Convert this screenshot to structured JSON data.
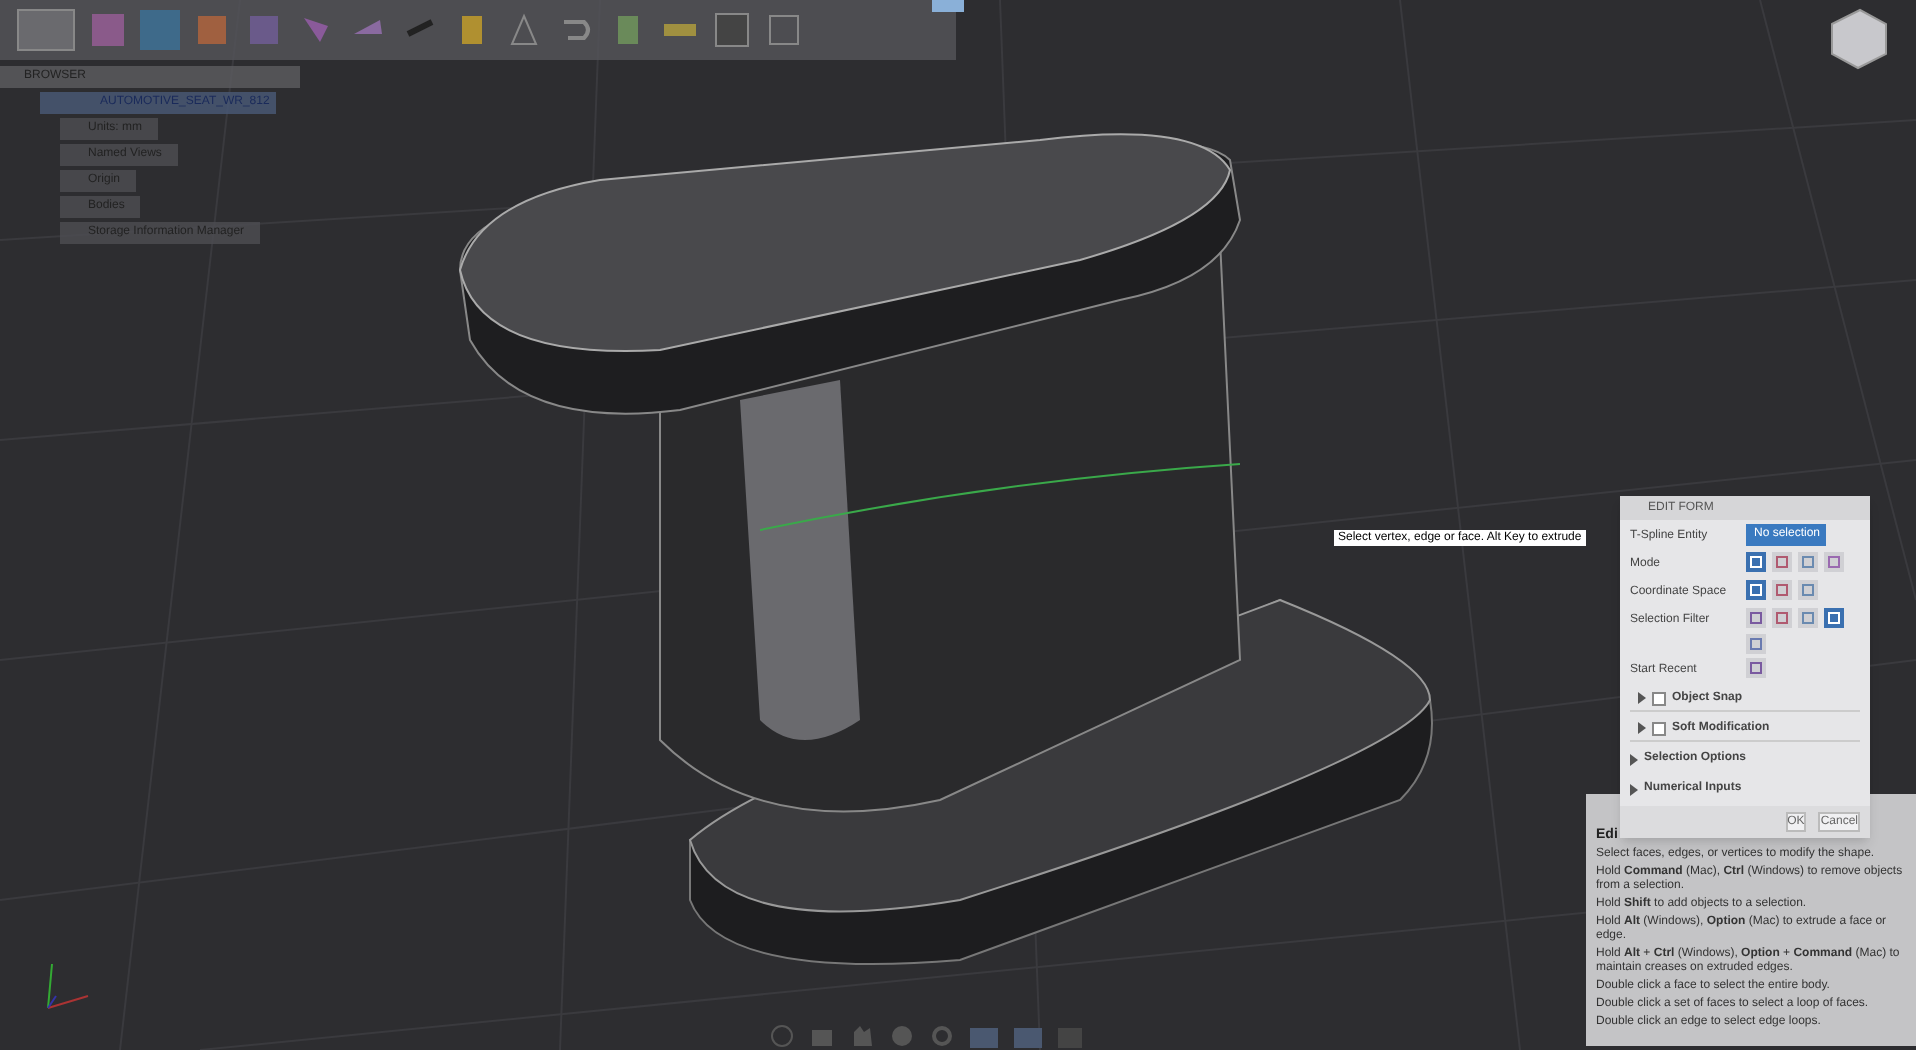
{
  "browser": {
    "title": "BROWSER",
    "items": [
      {
        "label": "AUTOMOTIVE_SEAT_WR_812",
        "selected": true,
        "children": [
          {
            "label": "Units: mm",
            "selected": false
          },
          {
            "label": "Named Views",
            "selected": false
          },
          {
            "label": "Origin",
            "selected": false
          },
          {
            "label": "Bodies",
            "selected": false
          },
          {
            "label": "Storage Information Manager",
            "selected": false
          }
        ]
      }
    ]
  },
  "viewport_hint": "Select vertex, edge or face. Alt Key to extrude",
  "edit_form": {
    "title": "EDIT FORM",
    "rows": [
      {
        "label": "T-Spline Entity",
        "kind": "field",
        "value": "No selection"
      },
      {
        "label": "Mode",
        "kind": "icons",
        "icons": [
          {
            "selected": true
          },
          {
            "selected": false
          },
          {
            "selected": false
          },
          {
            "selected": false
          }
        ]
      },
      {
        "label": "Coordinate Space",
        "kind": "icons",
        "icons": [
          {
            "selected": true
          },
          {
            "selected": false
          },
          {
            "selected": false
          }
        ]
      },
      {
        "label": "Selection Filter",
        "kind": "icons",
        "icons": [
          {
            "selected": false
          },
          {
            "selected": false
          },
          {
            "selected": false
          },
          {
            "selected": true
          },
          {
            "selected": false
          }
        ]
      },
      {
        "label": "Start Recent",
        "kind": "icons",
        "icons": [
          {
            "selected": false
          }
        ]
      }
    ],
    "sections": [
      {
        "label": "Object Snap",
        "kind": "checkbox",
        "checked": false
      },
      {
        "label": "Soft Modification",
        "kind": "checkbox",
        "checked": false
      },
      {
        "label": "Selection Options",
        "kind": "plain"
      },
      {
        "label": "Numerical Inputs",
        "kind": "plain"
      }
    ],
    "buttons": [
      "OK",
      "Cancel"
    ]
  },
  "help": {
    "title": "Edi",
    "lines": [
      "Select faces, edges, or vertices to modify the shape.",
      "Hold **Command** (Mac), **Ctrl** (Windows) to remove objects from a selection.",
      "Hold **Shift** to add objects to a selection.",
      "Hold **Alt** (Windows), **Option** (Mac) to extrude a face or edge.",
      "Hold **Alt** + **Ctrl** (Windows), **Option** + **Command** (Mac) to maintain creases on extruded edges.",
      "Double click a face to select the entire body.",
      "Double click a set of faces to select a loop of faces.",
      "Double click an edge to select edge loops."
    ]
  }
}
